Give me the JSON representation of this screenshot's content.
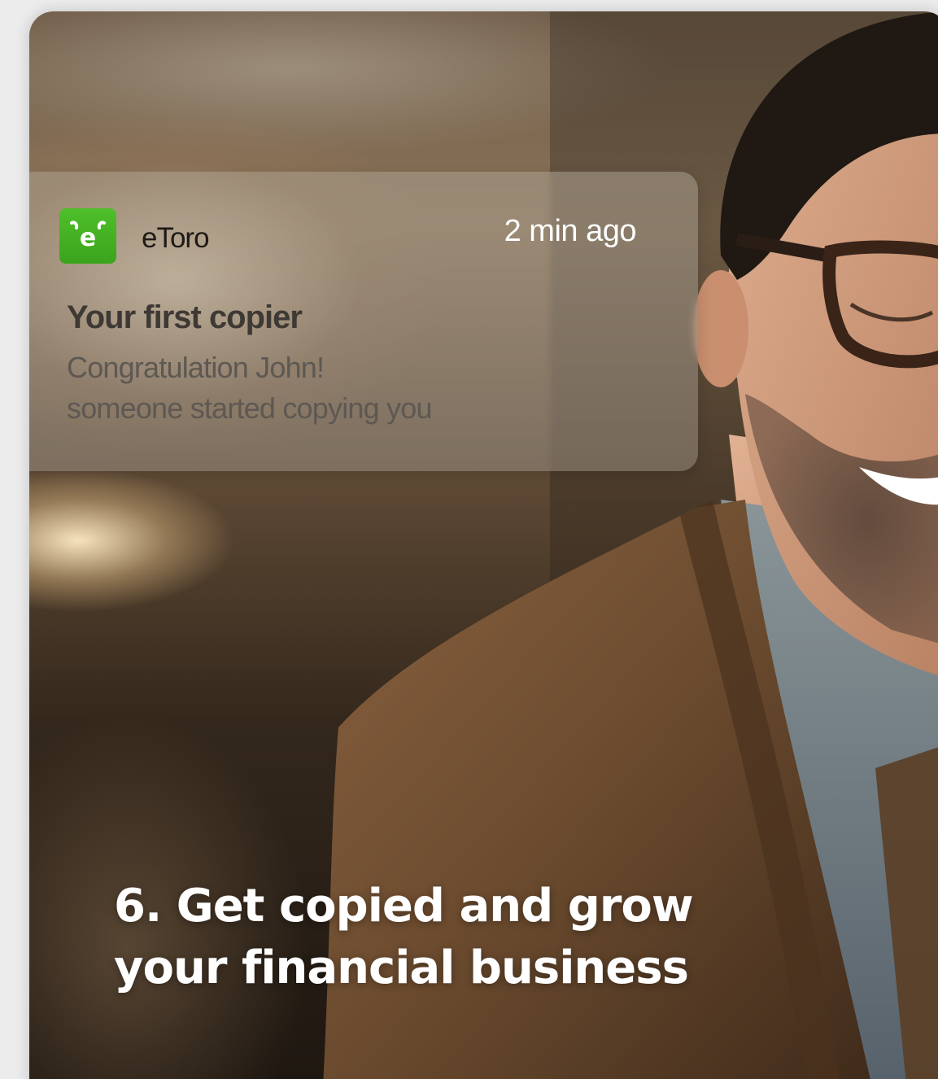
{
  "notification": {
    "app_name": "eToro",
    "app_icon": "etoro-logo-icon",
    "timestamp": "2 min ago",
    "title": "Your first copier",
    "body_line1": "Congratulation John!",
    "body_line2": "someone started copying you"
  },
  "headline": {
    "line1": "6. Get copied and grow",
    "line2": "your financial business"
  },
  "colors": {
    "brand_green": "#3aa41c",
    "headline_text": "#ffffff"
  },
  "image": {
    "subject": "smiling-man-with-glasses-photo"
  }
}
